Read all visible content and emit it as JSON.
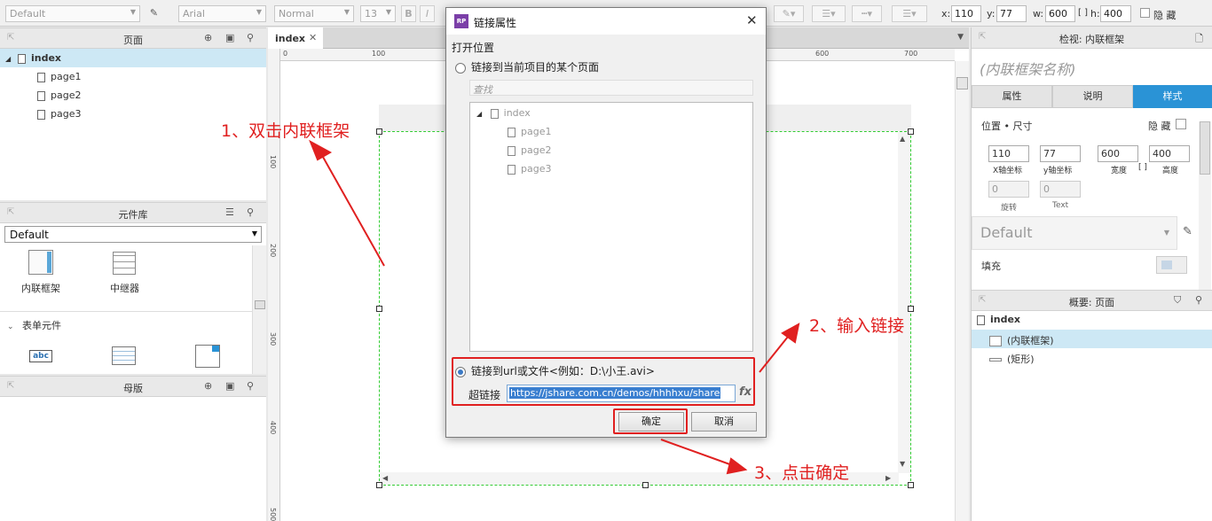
{
  "toolbar": {
    "style_select": "Default",
    "font_select": "Arial",
    "weight_select": "Normal",
    "size_select": "13",
    "bold": "B",
    "italic": "I",
    "x_label": "x:",
    "x_value": "110",
    "y_label": "y:",
    "y_value": "77",
    "w_label": "w:",
    "w_value": "600",
    "h_label": "h:",
    "h_value": "400",
    "hide_label": "隐 藏"
  },
  "pages_panel": {
    "title": "页面",
    "items": [
      {
        "label": "index"
      },
      {
        "label": "page1"
      },
      {
        "label": "page2"
      },
      {
        "label": "page3"
      }
    ]
  },
  "library_panel": {
    "title": "元件库",
    "selected_library": "Default",
    "widgets": [
      {
        "label": "内联框架"
      },
      {
        "label": "中继器"
      }
    ],
    "section": "表单元件",
    "form_text": "abc"
  },
  "masters_panel": {
    "title": "母版"
  },
  "canvas": {
    "tab_label": "index",
    "ruler_h": [
      "0",
      "100",
      "600",
      "700"
    ],
    "ruler_v": [
      "100",
      "200",
      "300",
      "400",
      "500"
    ]
  },
  "inspector": {
    "header": "检视: 内联框架",
    "name_placeholder": "(内联框架名称)",
    "tabs": [
      "属性",
      "说明",
      "样式"
    ],
    "position_size": "位置 • 尺寸",
    "hide": "隐 藏",
    "x": "110",
    "y": "77",
    "w": "600",
    "h": "400",
    "x_caption": "X轴坐标",
    "y_caption": "y轴坐标",
    "w_caption": "宽度",
    "h_caption": "高度",
    "rotate": "0",
    "text_rotate": "0",
    "rotate_caption": "旋转",
    "text_caption": "Text",
    "style_value": "Default",
    "fill_label": "填充"
  },
  "outline": {
    "title": "概要: 页面",
    "root": "index",
    "items": [
      "(内联框架)",
      "(矩形)"
    ]
  },
  "dialog": {
    "title": "链接属性",
    "app_badge": "RP",
    "open_location": "打开位置",
    "option_page": "链接到当前项目的某个页面",
    "search_placeholder": "查找",
    "tree": [
      "index",
      "page1",
      "page2",
      "page3"
    ],
    "option_url": "链接到url或文件<例如：D:\\小王.avi>",
    "hyperlink_label": "超链接",
    "hyperlink_value": "https://jshare.com.cn/demos/hhhhxu/share",
    "fx": "fx",
    "ok": "确定",
    "cancel": "取消"
  },
  "annotations": {
    "step1": "1、双击内联框架",
    "step2": "2、输入链接",
    "step3": "3、点击确定"
  },
  "colors": {
    "annotation_red": "#e02020",
    "selection_green": "#33cc33",
    "accent_blue": "#2a93d6"
  }
}
